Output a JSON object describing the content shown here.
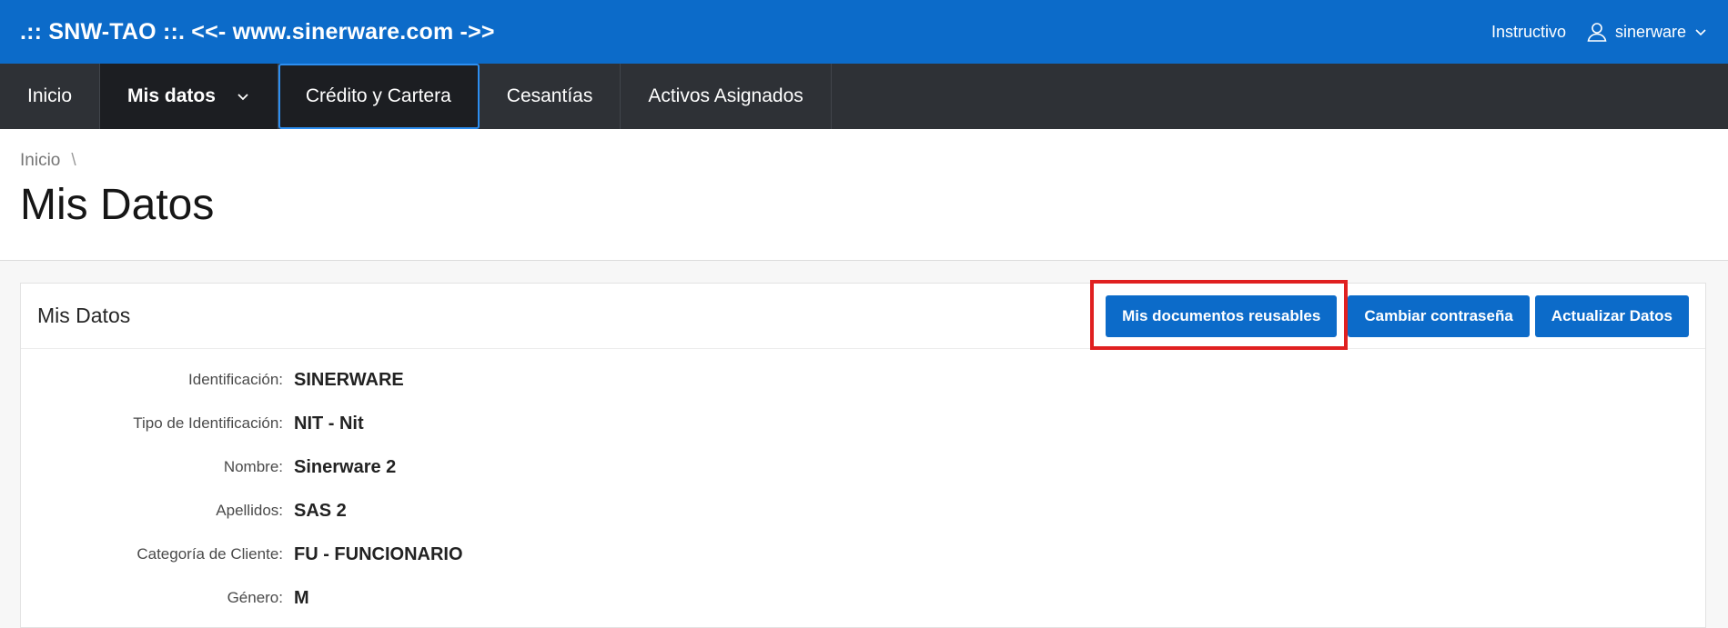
{
  "header": {
    "brand": ".:: SNW-TAO ::. <<- www.sinerware.com ->>",
    "instructivo": "Instructivo",
    "username": "sinerware",
    "user_icon": "user-icon",
    "colors": {
      "brand_blue": "#0c6bc9",
      "nav_bg": "#2e3136"
    }
  },
  "nav": {
    "items": [
      {
        "label": "Inicio"
      },
      {
        "label": "Mis datos"
      },
      {
        "label": "Crédito y Cartera"
      },
      {
        "label": "Cesantías"
      },
      {
        "label": "Activos Asignados"
      }
    ]
  },
  "breadcrumb": {
    "item": "Inicio",
    "separator": "\\"
  },
  "page": {
    "title": "Mis Datos"
  },
  "card": {
    "title": "Mis Datos",
    "buttons": {
      "documents": "Mis documentos reusables",
      "password": "Cambiar contraseña",
      "update": "Actualizar Datos"
    },
    "fields": [
      {
        "label": "Identificación:",
        "value": "SINERWARE"
      },
      {
        "label": "Tipo de Identificación:",
        "value": "NIT - Nit"
      },
      {
        "label": "Nombre:",
        "value": "Sinerware 2"
      },
      {
        "label": "Apellidos:",
        "value": "SAS 2"
      },
      {
        "label": "Categoría de Cliente:",
        "value": "FU - FUNCIONARIO"
      },
      {
        "label": "Género:",
        "value": "M"
      }
    ]
  }
}
